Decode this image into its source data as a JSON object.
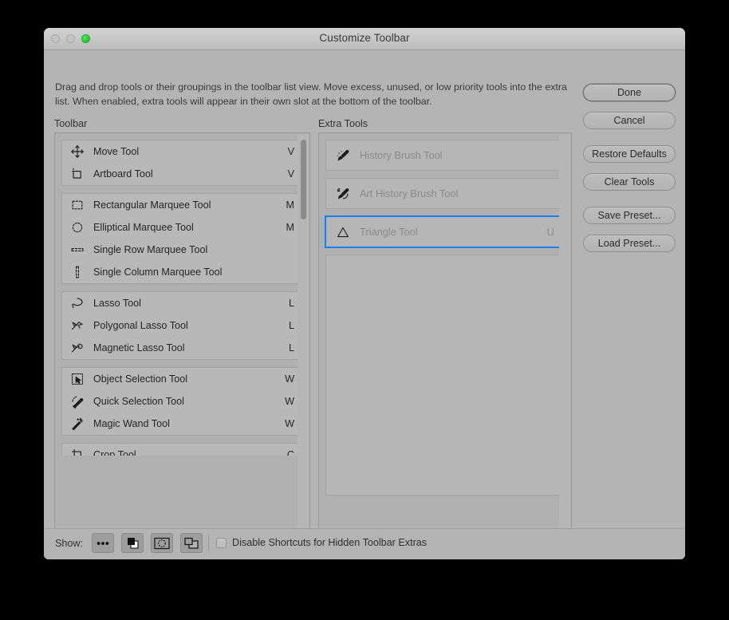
{
  "window": {
    "title": "Customize Toolbar",
    "traffic_lights": [
      "close-disabled",
      "minimize-disabled",
      "zoom-green"
    ]
  },
  "description": "Drag and drop tools or their groupings in the toolbar list view. Move excess, unused, or low priority tools into the extra list. When enabled, extra tools will appear in their own slot at the bottom of the toolbar.",
  "columns": {
    "toolbar_label": "Toolbar",
    "extra_label": "Extra Tools"
  },
  "toolbar_groups": [
    {
      "tools": [
        {
          "icon": "move-tool-icon",
          "name": "Move Tool",
          "shortcut": "V"
        },
        {
          "icon": "artboard-tool-icon",
          "name": "Artboard Tool",
          "shortcut": "V"
        }
      ]
    },
    {
      "tools": [
        {
          "icon": "rectangular-marquee-tool-icon",
          "name": "Rectangular Marquee Tool",
          "shortcut": "M"
        },
        {
          "icon": "elliptical-marquee-tool-icon",
          "name": "Elliptical Marquee Tool",
          "shortcut": "M"
        },
        {
          "icon": "single-row-marquee-tool-icon",
          "name": "Single Row Marquee Tool",
          "shortcut": ""
        },
        {
          "icon": "single-column-marquee-tool-icon",
          "name": "Single Column Marquee Tool",
          "shortcut": ""
        }
      ]
    },
    {
      "tools": [
        {
          "icon": "lasso-tool-icon",
          "name": "Lasso Tool",
          "shortcut": "L"
        },
        {
          "icon": "polygonal-lasso-tool-icon",
          "name": "Polygonal Lasso Tool",
          "shortcut": "L"
        },
        {
          "icon": "magnetic-lasso-tool-icon",
          "name": "Magnetic Lasso Tool",
          "shortcut": "L"
        }
      ]
    },
    {
      "tools": [
        {
          "icon": "object-selection-tool-icon",
          "name": "Object Selection Tool",
          "shortcut": "W"
        },
        {
          "icon": "quick-selection-tool-icon",
          "name": "Quick Selection Tool",
          "shortcut": "W"
        },
        {
          "icon": "magic-wand-tool-icon",
          "name": "Magic Wand Tool",
          "shortcut": "W"
        }
      ]
    }
  ],
  "toolbar_clipped_row": {
    "icon": "crop-tool-icon",
    "name": "Crop Tool",
    "shortcut": "C"
  },
  "extra_tools": [
    {
      "icon": "history-brush-tool-icon",
      "name": "History Brush Tool",
      "shortcut": "",
      "selected": false
    },
    {
      "icon": "art-history-brush-tool-icon",
      "name": "Art History Brush Tool",
      "shortcut": "",
      "selected": false
    },
    {
      "icon": "triangle-tool-icon",
      "name": "Triangle Tool",
      "shortcut": "U",
      "selected": true
    }
  ],
  "buttons": {
    "done": "Done",
    "cancel": "Cancel",
    "restore_defaults": "Restore Defaults",
    "clear_tools": "Clear Tools",
    "save_preset": "Save Preset...",
    "load_preset": "Load Preset..."
  },
  "footer": {
    "show_label": "Show:",
    "toggles": [
      {
        "icon": "ellipsis-extras-icon"
      },
      {
        "icon": "foreground-background-color-icon"
      },
      {
        "icon": "quick-mask-mode-icon"
      },
      {
        "icon": "screen-mode-icon"
      }
    ],
    "checkbox": {
      "label": "Disable Shortcuts for Hidden Toolbar Extras",
      "checked": false
    }
  },
  "colors": {
    "selection_blue": "#1a7ef5",
    "dialog_bg": "#b4b4b4",
    "list_bg": "#b0b0b0",
    "group_bg": "#b8b8b8",
    "zoom_green": "#28cb38"
  }
}
